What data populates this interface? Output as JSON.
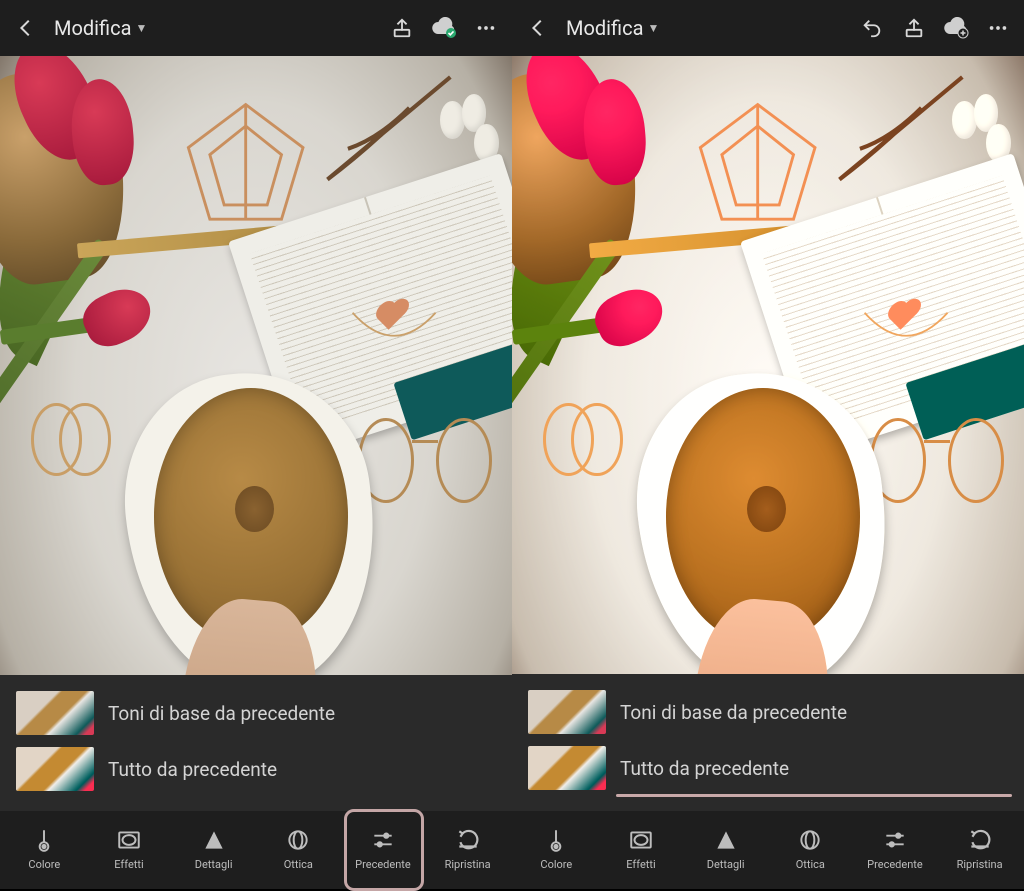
{
  "left": {
    "header": {
      "title": "Modifica",
      "cloud_status": "synced"
    },
    "popup": {
      "option1": "Toni di base da precedente",
      "option2": "Tutto da precedente"
    },
    "toolbar": {
      "colore": "Colore",
      "effetti": "Effetti",
      "dettagli": "Dettagli",
      "ottica": "Ottica",
      "precedente": "Precedente",
      "ripristina": "Ripristina",
      "highlighted": "precedente"
    }
  },
  "right": {
    "header": {
      "title": "Modifica",
      "cloud_status": "pending"
    },
    "popup": {
      "option1": "Toni di base da precedente",
      "option2": "Tutto da precedente",
      "selected_underline": true
    },
    "toolbar": {
      "colore": "Colore",
      "effetti": "Effetti",
      "dettagli": "Dettagli",
      "ottica": "Ottica",
      "precedente": "Precedente",
      "ripristina": "Ripristina"
    }
  }
}
